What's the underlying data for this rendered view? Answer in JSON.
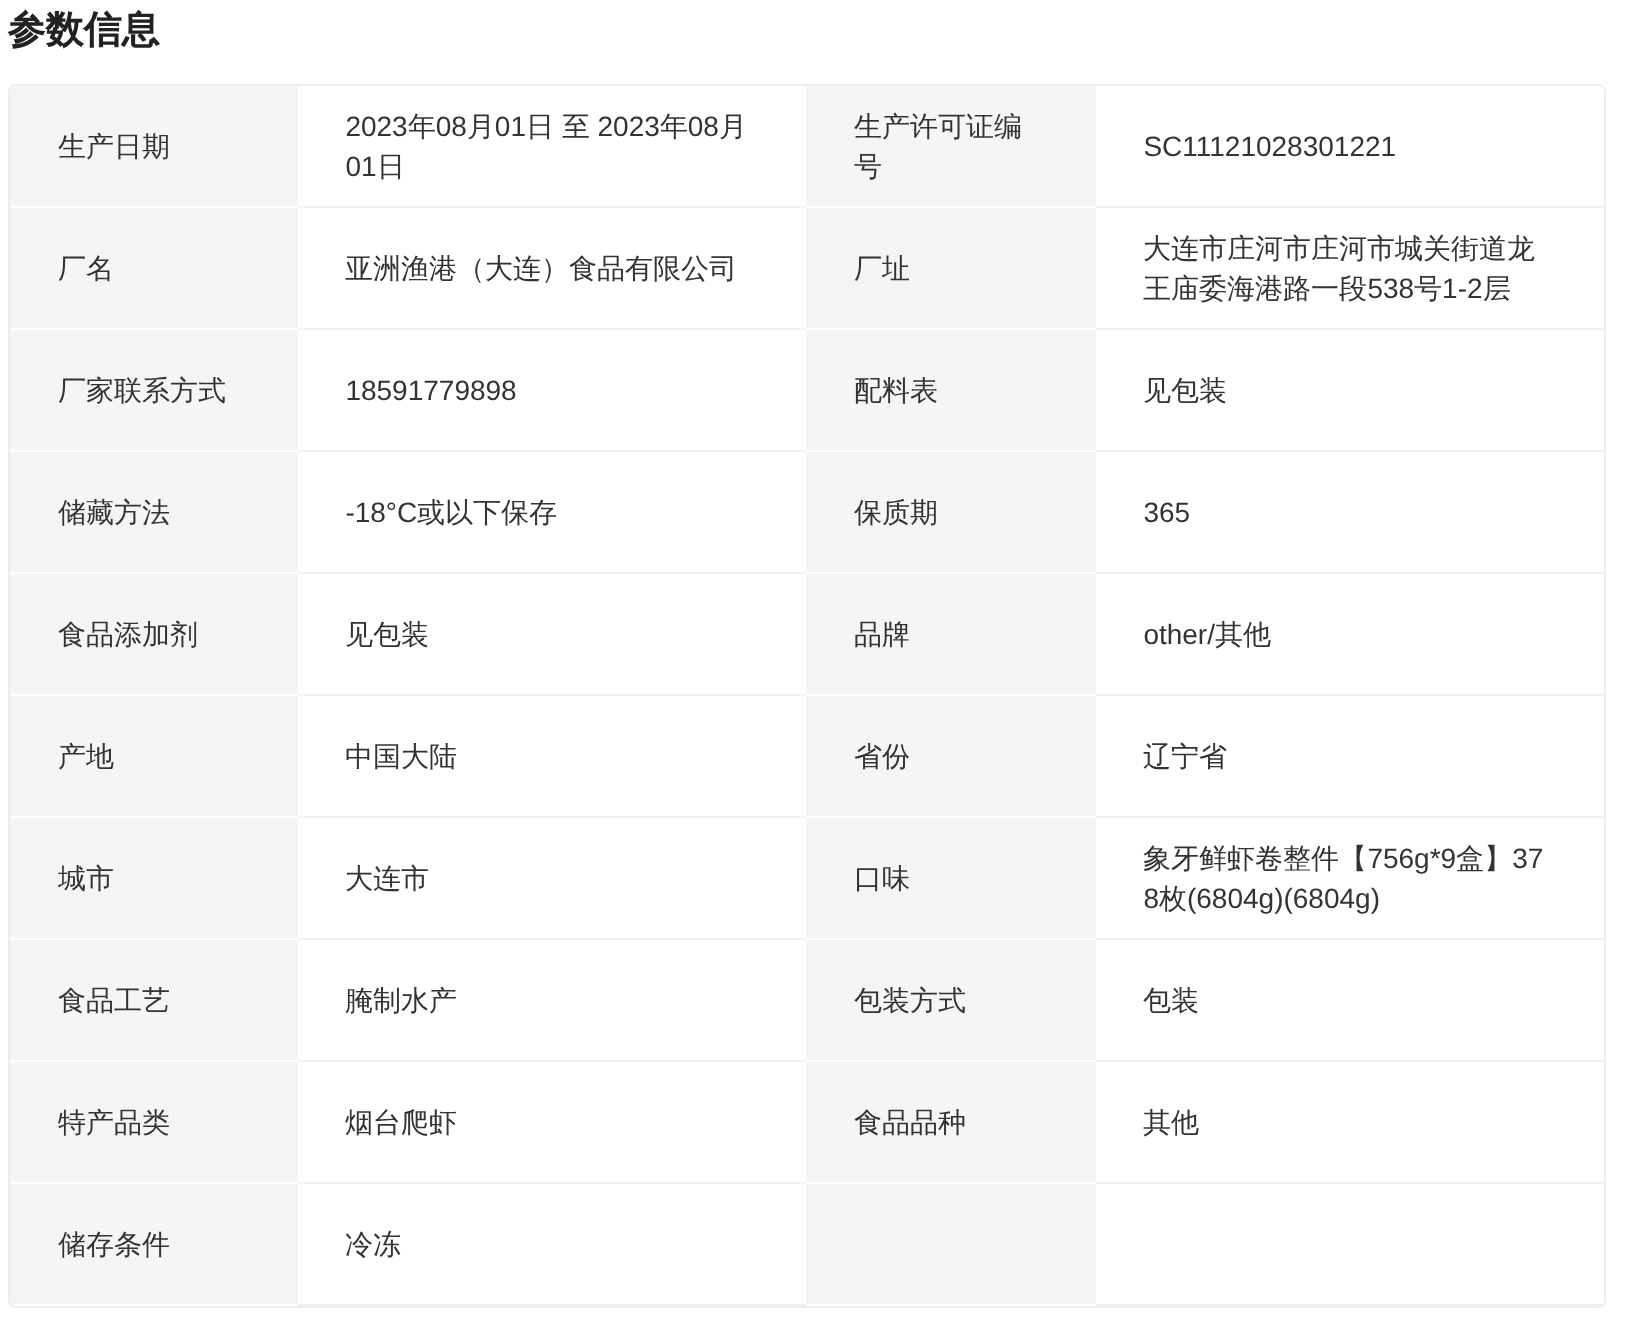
{
  "title": "参数信息",
  "rows": [
    {
      "params": [
        {
          "label": "生产日期",
          "value": "2023年08月01日 至 2023年08月01日"
        },
        {
          "label": "生产许可证编号",
          "value": "SC11121028301221"
        }
      ]
    },
    {
      "params": [
        {
          "label": "厂名",
          "value": "亚洲渔港（大连）食品有限公司"
        },
        {
          "label": "厂址",
          "value": "大连市庄河市庄河市城关街道龙王庙委海港路一段538号1-2层"
        }
      ]
    },
    {
      "params": [
        {
          "label": "厂家联系方式",
          "value": "18591779898"
        },
        {
          "label": "配料表",
          "value": "见包装"
        }
      ]
    },
    {
      "params": [
        {
          "label": "储藏方法",
          "value": "-18°C或以下保存"
        },
        {
          "label": "保质期",
          "value": "365"
        }
      ]
    },
    {
      "params": [
        {
          "label": "食品添加剂",
          "value": "见包装"
        },
        {
          "label": "品牌",
          "value": "other/其他"
        }
      ]
    },
    {
      "params": [
        {
          "label": "产地",
          "value": "中国大陆"
        },
        {
          "label": "省份",
          "value": "辽宁省"
        }
      ]
    },
    {
      "params": [
        {
          "label": "城市",
          "value": "大连市"
        },
        {
          "label": "口味",
          "value": "象牙鲜虾卷整件【756g*9盒】378枚(6804g)(6804g)"
        }
      ]
    },
    {
      "params": [
        {
          "label": "食品工艺",
          "value": "腌制水产"
        },
        {
          "label": "包装方式",
          "value": "包装"
        }
      ]
    },
    {
      "params": [
        {
          "label": "特产品类",
          "value": "烟台爬虾"
        },
        {
          "label": "食品品种",
          "value": "其他"
        }
      ]
    },
    {
      "params": [
        {
          "label": "储存条件",
          "value": "冷冻"
        }
      ]
    }
  ]
}
